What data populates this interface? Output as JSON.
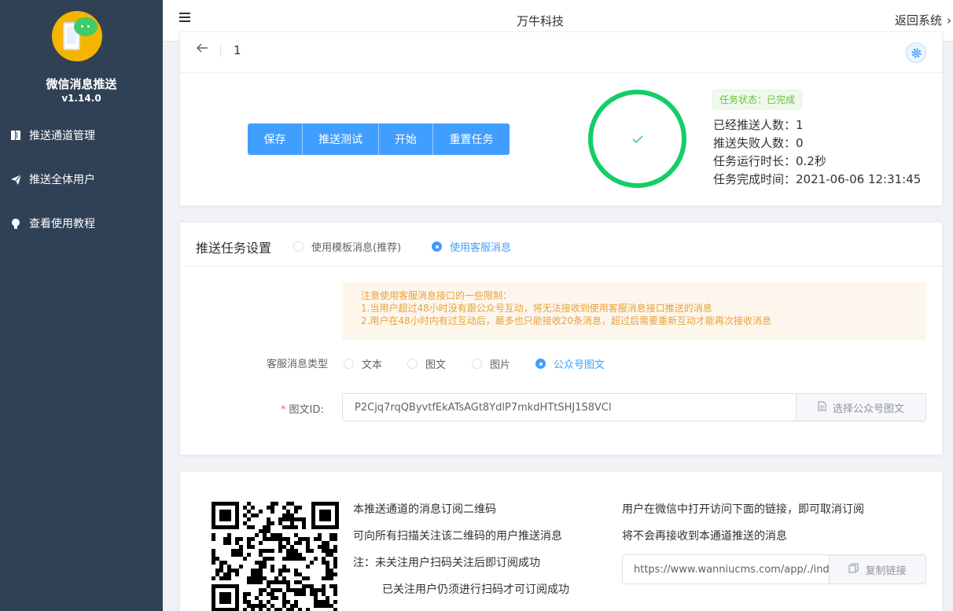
{
  "app": {
    "name": "微信消息推送",
    "version": "v1.14.0"
  },
  "sidebar": {
    "items": [
      {
        "label": "推送通道管理",
        "icon": "book-icon"
      },
      {
        "label": "推送全体用户",
        "icon": "send-icon"
      },
      {
        "label": "查看使用教程",
        "icon": "bulb-icon"
      }
    ]
  },
  "header": {
    "title": "万牛科技",
    "back_label": "返回系统",
    "back_chevron": "›"
  },
  "task": {
    "page": "1",
    "buttons": [
      "保存",
      "推送测试",
      "开始",
      "重置任务"
    ],
    "status_tag": "任务状态：已完成",
    "progress_percent": 100,
    "stats": [
      "已经推送人数：1",
      "推送失败人数：0",
      "任务运行时长：0.2秒",
      "任务完成时间：2021-06-06 12:31:45"
    ]
  },
  "settings": {
    "title": "推送任务设置",
    "mode_options": [
      "使用模板消息(推荐)",
      "使用客服消息"
    ],
    "mode_selected": 1,
    "notice": [
      "注意使用客服消息接口的一些限制：",
      "1.当用户超过48小时没有跟公众号互动，将无法接收到使用客服消息接口推送的消息",
      "2.用户在48小时内有过互动后，最多也只能接收20条消息，超过后需要重新互动才能再次接收消息"
    ],
    "msg_type_label": "客服消息类型",
    "msg_types": [
      "文本",
      "图文",
      "图片",
      "公众号图文"
    ],
    "msg_type_selected": 3,
    "id_label": "图文ID:",
    "id_value": "P2Cjq7rqQByvtfEkATsAGt8YdlP7mkdHTtSHJ1S8VCl",
    "select_button": "选择公众号图文"
  },
  "subscribe": {
    "qr_lines": [
      "本推送通道的消息订阅二维码",
      "可向所有扫描关注该二维码的用户推送消息",
      "注：未关注用户扫码关注后即订阅成功",
      "已关注用户仍须进行扫码才可订阅成功"
    ],
    "unsub_lines": [
      "用户在微信中打开访问下面的链接，即可取消订阅",
      "将不会再接收到本通道推送的消息"
    ],
    "link_value": "https://www.wanniucms.com/app/./index",
    "copy_button": "复制链接"
  },
  "colors": {
    "sidebar": "#304156",
    "primary": "#409eff",
    "success": "#13ce66",
    "warning": "#e6a23c"
  }
}
